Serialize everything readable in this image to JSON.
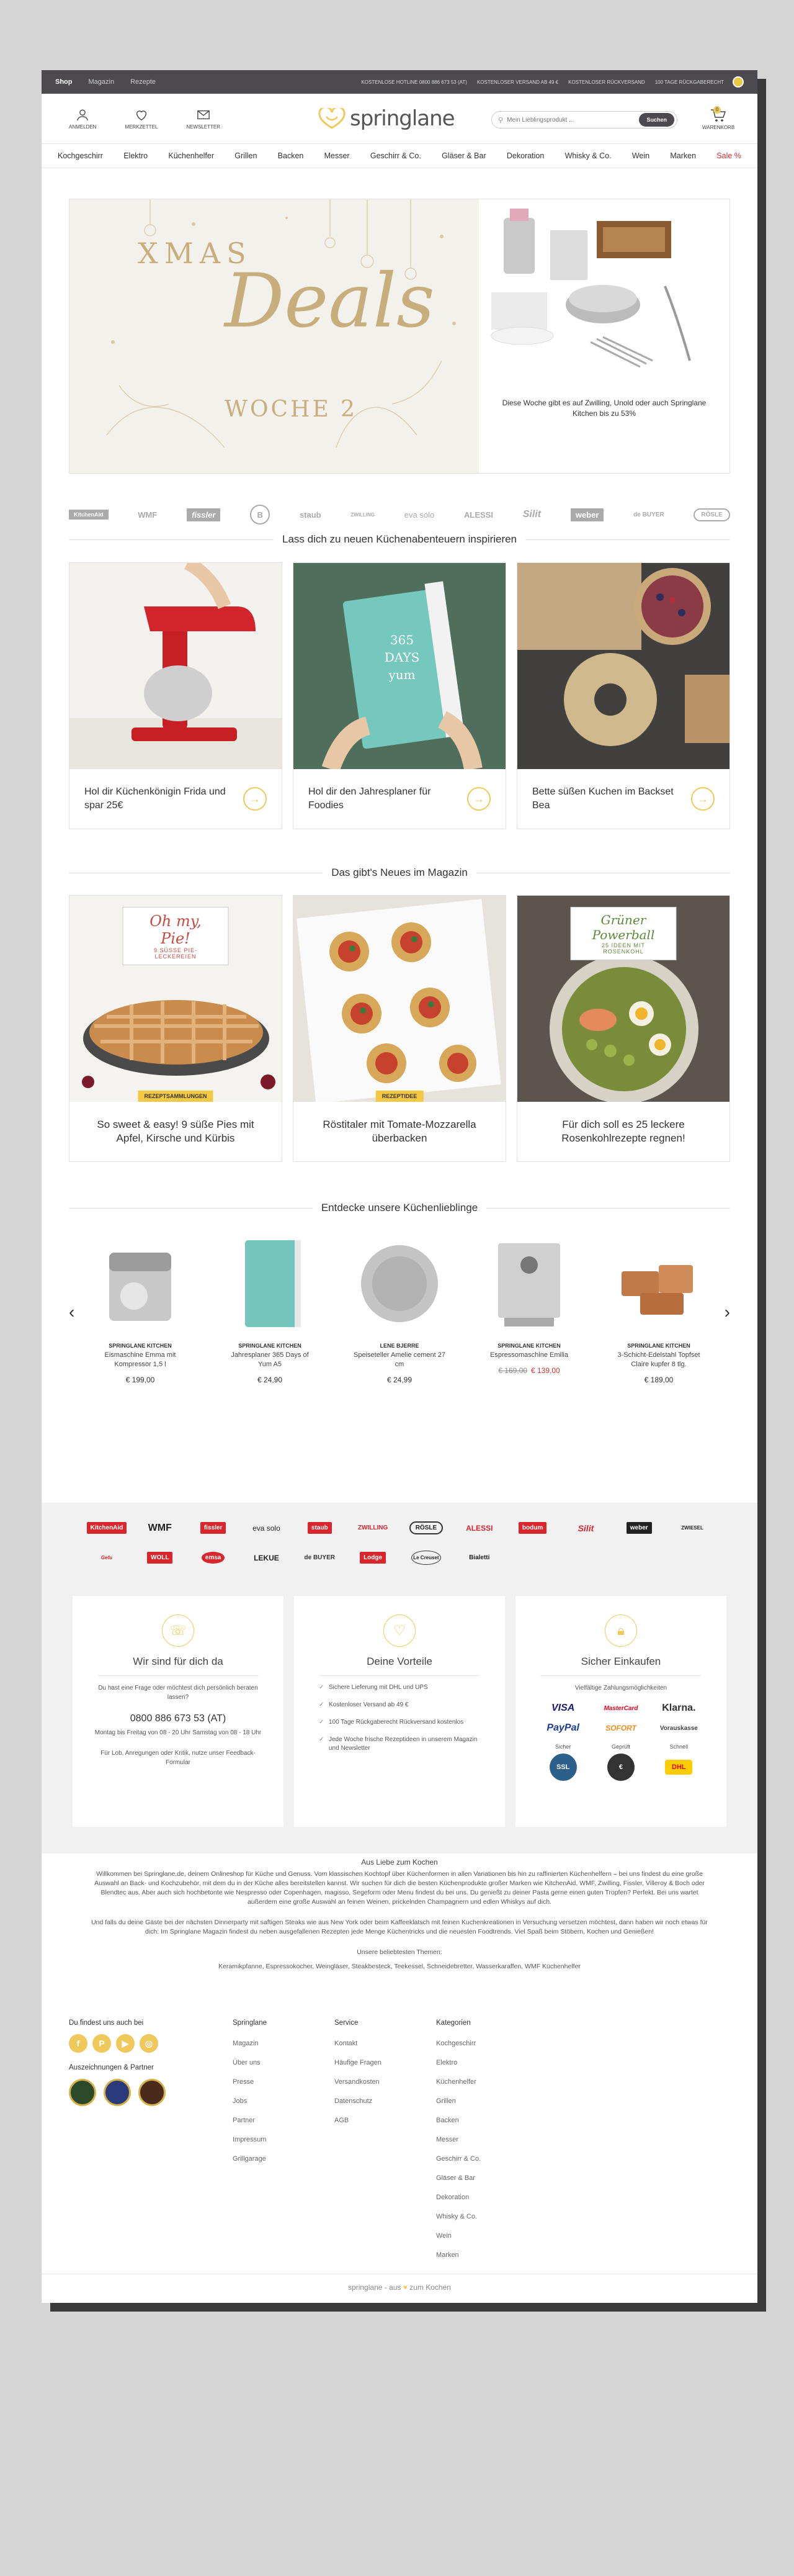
{
  "topbar": {
    "tabs": [
      "Shop",
      "Magazin",
      "Rezepte"
    ],
    "usps": [
      "Kostenlose Hotline 0800 886 673 53 (AT)",
      "Kostenloser Versand ab 49 €",
      "Kostenloser Rückversand",
      "100 Tage Rückgaberecht"
    ]
  },
  "header": {
    "login": "Anmelden",
    "wishlist": "Merkzettel",
    "newsletter": "Newsletter",
    "logo": "springlane",
    "search_placeholder": "Mein Lieblingsprodukt ...",
    "search_button": "Suchen",
    "cart": "Warenkorb",
    "cart_count": "0"
  },
  "nav": [
    "Kochgeschirr",
    "Elektro",
    "Küchenhelfer",
    "Grillen",
    "Backen",
    "Messer",
    "Geschirr & Co.",
    "Gläser & Bar",
    "Dekoration",
    "Whisky & Co.",
    "Wein",
    "Marken",
    "Sale %"
  ],
  "hero": {
    "line1": "XMAS",
    "line2": "Deals",
    "line3": "WOCHE 2",
    "text": "Diese Woche gibt es auf Zwilling, Unold oder auch Springlane Kitchen bis zu 53%"
  },
  "brands_top": [
    "KitchenAid",
    "WMF",
    "fissler",
    "B",
    "staub",
    "ZWILLING",
    "eva solo",
    "ALESSI",
    "Silit",
    "weber",
    "de BUYER",
    "RÖSLE"
  ],
  "inspire": {
    "title": "Lass dich zu neuen Küchenabenteuern inspirieren",
    "cards": [
      {
        "caption": "Hol dir Küchenkönigin Frida und spar 25€"
      },
      {
        "caption": "Hol dir den Jahresplaner für Foodies",
        "img_text": "365 DAYS yum"
      },
      {
        "caption": "Bette süßen Kuchen im Backset Bea"
      }
    ]
  },
  "magazine": {
    "title": "Das gibt's Neues im Magazin",
    "cards": [
      {
        "sign_title": "Oh my, Pie!",
        "sign_sub": "9 SÜSSE PIE-LECKEREIEN",
        "badge": "Rezeptsammlungen",
        "caption": "So sweet & easy! 9 süße Pies mit Apfel, Kirsche und Kürbis"
      },
      {
        "badge": "Rezeptidee",
        "caption": "Röstitaler mit Tomate-Mozzarella überbacken"
      },
      {
        "sign_title": "Grüner Powerball",
        "sign_sub": "25 IDEEN MIT ROSENKOHL",
        "caption": "Für dich soll es 25 leckere Rosenkohlrezepte regnen!"
      }
    ]
  },
  "favorites": {
    "title": "Entdecke unsere Küchenlieblinge",
    "products": [
      {
        "brand": "Springlane Kitchen",
        "name": "Eismaschine Emma mit Kompressor 1,5 l",
        "price": "€ 199,00"
      },
      {
        "brand": "Springlane Kitchen",
        "name": "Jahresplaner 365 Days of Yum A5",
        "price": "€ 24,90"
      },
      {
        "brand": "Lene Bjerre",
        "name": "Speiseteller Amelie cement 27 cm",
        "price": "€ 24,99"
      },
      {
        "brand": "Springlane Kitchen",
        "name": "Espressomaschine Emilia",
        "old_price": "€ 169,00",
        "price": "€ 139,00"
      },
      {
        "brand": "Springlane Kitchen",
        "name": "3-Schicht-Edelstahl Topfset Claire kupfer 8 tlg.",
        "price": "€ 189,00"
      }
    ]
  },
  "brands_grid": [
    "KitchenAid",
    "WMF",
    "fissler",
    "eva solo",
    "staub",
    "ZWILLING",
    "RÖSLE",
    "ALESSI",
    "bodum",
    "Silit",
    "weber",
    "ZWIESEL",
    "Gefu",
    "WOLL",
    "emsa",
    "LEKUE",
    "de BUYER",
    "Lodge",
    "Le Creuset",
    "Bialetti"
  ],
  "info": {
    "contact": {
      "title": "Wir sind für dich da",
      "text": "Du hast eine Frage oder möchtest dich persönlich beraten lassen?",
      "phone": "0800 886 673 53 (AT)",
      "hours": "Montag bis Freitag von 08 - 20 Uhr Samstag von 08 - 18 Uhr",
      "feedback": "Für Lob, Anregungen oder Kritik, nutze unser Feedback-Formular"
    },
    "benefits": {
      "title": "Deine Vorteile",
      "items": [
        "Sichere Lieferung mit DHL und UPS",
        "Kostenloser Versand ab 49 €",
        "100 Tage Rückgaberecht Rückversand kostenlos",
        "Jede Woche frische Rezeptideen in unserem Magazin und Newsletter"
      ]
    },
    "secure": {
      "title": "Sicher Einkaufen",
      "subtitle": "Vielfältige Zahlungsmöglichkeiten",
      "payments": [
        "VISA",
        "MasterCard",
        "Klarna.",
        "PayPal",
        "SOFORT",
        "Vorauskasse"
      ],
      "seals": [
        {
          "label": "Sicher",
          "badge": "SSL"
        },
        {
          "label": "Geprüft",
          "badge": "€"
        },
        {
          "label": "Schnell",
          "badge": "DHL"
        }
      ]
    }
  },
  "about": {
    "title": "Aus Liebe zum Kochen",
    "p1": "Willkommen bei Springlane.de, deinem Onlineshop für Küche und Genuss. Vom klassischen Kochtopf über Küchenformen in allen Variationen bis hin zu raffinierten Küchenhelfern – bei uns findest du eine große Auswahl an Back- und Kochzubehör, mit dem du in der Küche alles bereitstellen kannst. Wir suchen für dich die besten Küchenprodukte großer Marken wie KitchenAid, WMF, Zwilling, Fissler, Villeroy & Boch oder Blendtec aus. Aber auch sich hochbetonte wie Nespresso oder Copenhagen, magisso, Segeform oder Menu findest du bei uns. Du genießt zu deiner Pasta gerne einen guten Tropfen? Perfekt. Bei uns wartet außerdem eine große Auswahl an feinen Weinen, prickelnden Champagnern und edlen Whiskys auf dich.",
    "p2": "Und falls du deine Gäste bei der nächsten Dinnerparty mit saftigen Steaks wie aus New York oder beim Kaffeeklatsch mit feinen Kuchenkreationen in Versuchung versetzen möchtest, dann haben wir noch etwas für dich: Im Springlane Magazin findest du neben ausgefallenen Rezepten jede Menge Küchentricks und die neuesten Foodtrends. Viel Spaß beim Stöbern, Kochen und Genießen!",
    "popular_title": "Unsere beliebtesten Themen:",
    "popular": "Keramikpfanne, Espressokocher, Weingläser, Steakbesteck, Teekessel, Schneidebretter, Wasserkaraffen, WMF Küchenhelfer"
  },
  "footer": {
    "social_title": "Du findest uns auch bei",
    "awards_title": "Auszeichnungen & Partner",
    "col1": {
      "title": "Springlane",
      "links": [
        "Magazin",
        "Über uns",
        "Presse",
        "Jobs",
        "Partner",
        "Impressum",
        "Grillgarage"
      ]
    },
    "col2": {
      "title": "Service",
      "links": [
        "Kontakt",
        "Häufige Fragen",
        "Versandkosten",
        "Datenschutz",
        "AGB"
      ]
    },
    "col3": {
      "title": "Kategorien",
      "links": [
        "Kochgeschirr",
        "Elektro",
        "Küchenhelfer",
        "Grillen",
        "Backen",
        "Messer",
        "Geschirr & Co.",
        "Gläser & Bar",
        "Dekoration",
        "Whisky & Co.",
        "Wein",
        "Marken"
      ]
    },
    "bottom_left": "springlane - aus",
    "bottom_right": "zum Kochen"
  },
  "colors": {
    "accent": "#f0c95b",
    "topbar": "#4c4a4f",
    "sale": "#d32f2f",
    "gold": "#c8ae7c"
  }
}
